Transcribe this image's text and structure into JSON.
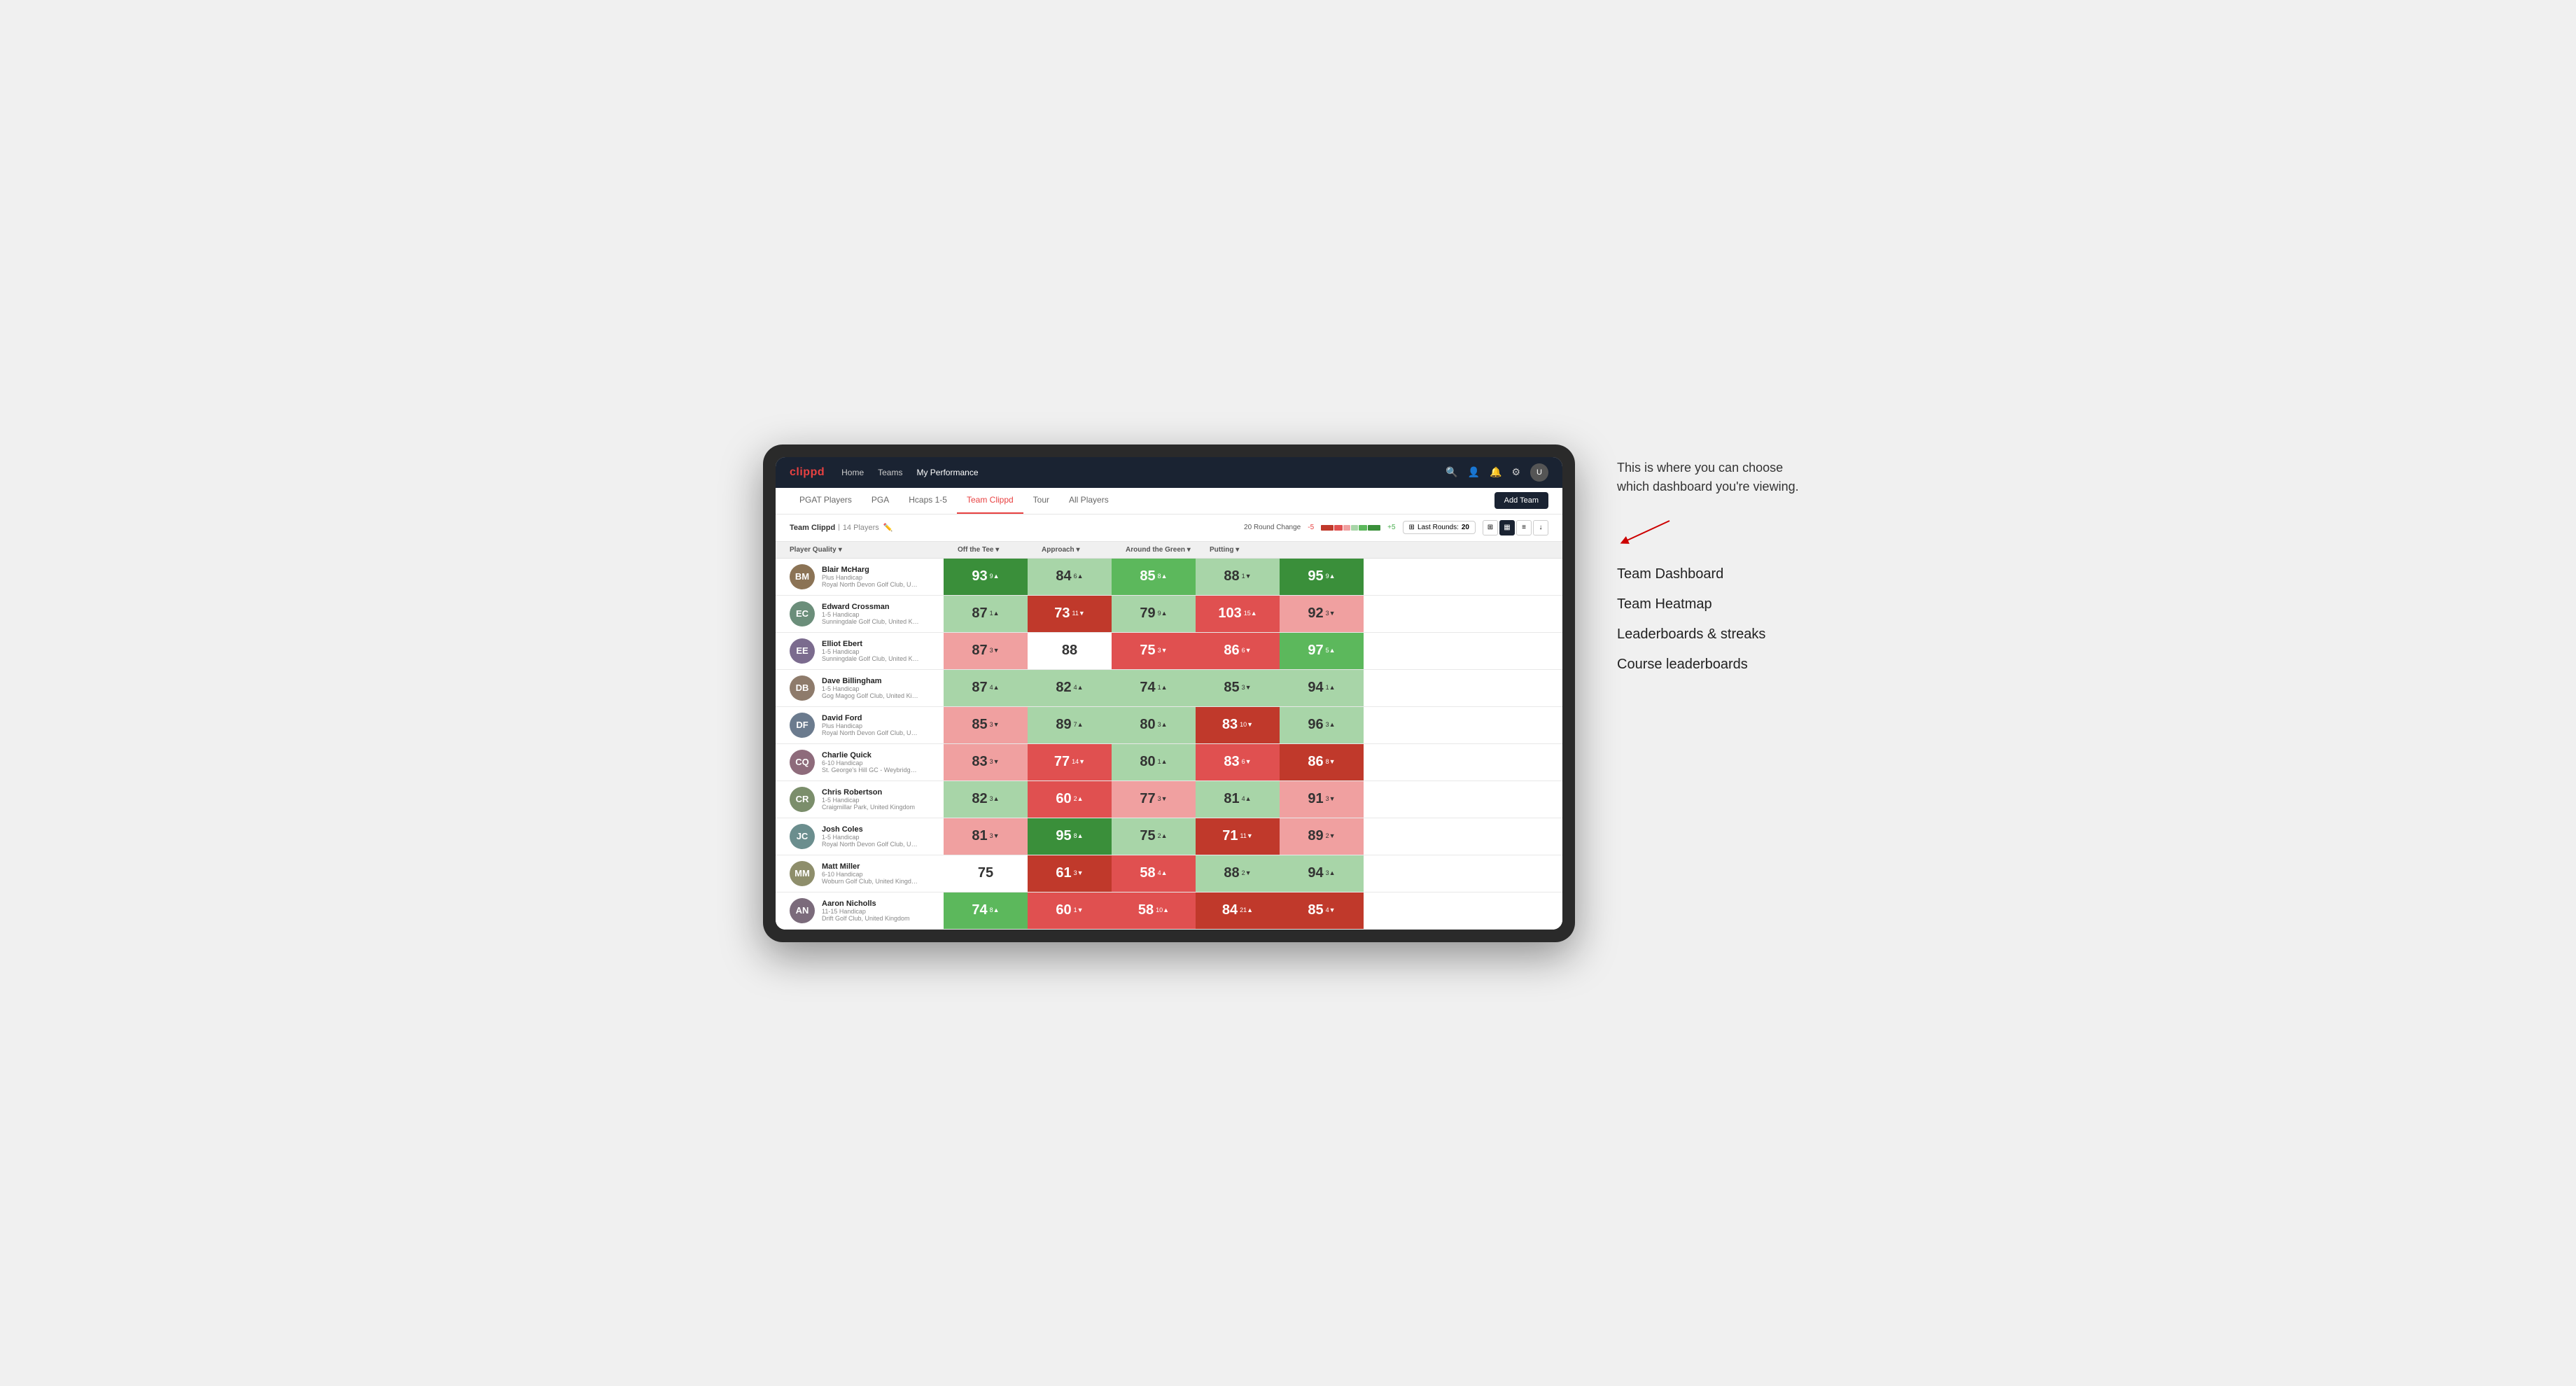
{
  "annotation": {
    "intro_text": "This is where you can choose which dashboard you're viewing.",
    "items": [
      "Team Dashboard",
      "Team Heatmap",
      "Leaderboards & streaks",
      "Course leaderboards"
    ]
  },
  "nav": {
    "logo": "clippd",
    "links": [
      "Home",
      "Teams",
      "My Performance"
    ],
    "active_link": "My Performance"
  },
  "sub_nav": {
    "links": [
      "PGAT Players",
      "PGA",
      "Hcaps 1-5",
      "Team Clippd",
      "Tour",
      "All Players"
    ],
    "active_link": "Team Clippd",
    "add_team_label": "Add Team"
  },
  "team_header": {
    "team_name": "Team Clippd",
    "player_count": "14 Players",
    "round_change_label": "20 Round Change",
    "round_change_minus": "-5",
    "round_change_plus": "+5",
    "last_rounds_label": "Last Rounds:",
    "last_rounds_value": "20"
  },
  "columns": [
    {
      "label": "Player Quality",
      "has_arrow": true
    },
    {
      "label": "Off the Tee",
      "has_arrow": true
    },
    {
      "label": "Approach",
      "has_arrow": true
    },
    {
      "label": "Around the Green",
      "has_arrow": true
    },
    {
      "label": "Putting",
      "has_arrow": true
    }
  ],
  "players": [
    {
      "name": "Blair McHarg",
      "handicap": "Plus Handicap",
      "club": "Royal North Devon Golf Club, United Kingdom",
      "scores": [
        {
          "value": "93",
          "change": "9",
          "dir": "up",
          "color": "green-dark"
        },
        {
          "value": "84",
          "change": "6",
          "dir": "up",
          "color": "green-light"
        },
        {
          "value": "85",
          "change": "8",
          "dir": "up",
          "color": "green-med"
        },
        {
          "value": "88",
          "change": "1",
          "dir": "down",
          "color": "green-light"
        },
        {
          "value": "95",
          "change": "9",
          "dir": "up",
          "color": "green-dark"
        }
      ]
    },
    {
      "name": "Edward Crossman",
      "handicap": "1-5 Handicap",
      "club": "Sunningdale Golf Club, United Kingdom",
      "scores": [
        {
          "value": "87",
          "change": "1",
          "dir": "up",
          "color": "green-light"
        },
        {
          "value": "73",
          "change": "11",
          "dir": "down",
          "color": "red-dark"
        },
        {
          "value": "79",
          "change": "9",
          "dir": "up",
          "color": "green-light"
        },
        {
          "value": "103",
          "change": "15",
          "dir": "up",
          "color": "red-med"
        },
        {
          "value": "92",
          "change": "3",
          "dir": "down",
          "color": "red-light"
        }
      ]
    },
    {
      "name": "Elliot Ebert",
      "handicap": "1-5 Handicap",
      "club": "Sunningdale Golf Club, United Kingdom",
      "scores": [
        {
          "value": "87",
          "change": "3",
          "dir": "down",
          "color": "red-light"
        },
        {
          "value": "88",
          "change": "",
          "dir": "",
          "color": "neutral"
        },
        {
          "value": "75",
          "change": "3",
          "dir": "down",
          "color": "red-med"
        },
        {
          "value": "86",
          "change": "6",
          "dir": "down",
          "color": "red-med"
        },
        {
          "value": "97",
          "change": "5",
          "dir": "up",
          "color": "green-med"
        }
      ]
    },
    {
      "name": "Dave Billingham",
      "handicap": "1-5 Handicap",
      "club": "Gog Magog Golf Club, United Kingdom",
      "scores": [
        {
          "value": "87",
          "change": "4",
          "dir": "up",
          "color": "green-light"
        },
        {
          "value": "82",
          "change": "4",
          "dir": "up",
          "color": "green-light"
        },
        {
          "value": "74",
          "change": "1",
          "dir": "up",
          "color": "green-light"
        },
        {
          "value": "85",
          "change": "3",
          "dir": "down",
          "color": "green-light"
        },
        {
          "value": "94",
          "change": "1",
          "dir": "up",
          "color": "green-light"
        }
      ]
    },
    {
      "name": "David Ford",
      "handicap": "Plus Handicap",
      "club": "Royal North Devon Golf Club, United Kingdom",
      "scores": [
        {
          "value": "85",
          "change": "3",
          "dir": "down",
          "color": "red-light"
        },
        {
          "value": "89",
          "change": "7",
          "dir": "up",
          "color": "green-light"
        },
        {
          "value": "80",
          "change": "3",
          "dir": "up",
          "color": "green-light"
        },
        {
          "value": "83",
          "change": "10",
          "dir": "down",
          "color": "red-dark"
        },
        {
          "value": "96",
          "change": "3",
          "dir": "up",
          "color": "green-light"
        }
      ]
    },
    {
      "name": "Charlie Quick",
      "handicap": "6-10 Handicap",
      "club": "St. George's Hill GC - Weybridge - Surrey, Uni...",
      "scores": [
        {
          "value": "83",
          "change": "3",
          "dir": "down",
          "color": "red-light"
        },
        {
          "value": "77",
          "change": "14",
          "dir": "down",
          "color": "red-med"
        },
        {
          "value": "80",
          "change": "1",
          "dir": "up",
          "color": "green-light"
        },
        {
          "value": "83",
          "change": "6",
          "dir": "down",
          "color": "red-med"
        },
        {
          "value": "86",
          "change": "8",
          "dir": "down",
          "color": "red-dark"
        }
      ]
    },
    {
      "name": "Chris Robertson",
      "handicap": "1-5 Handicap",
      "club": "Craigmillar Park, United Kingdom",
      "scores": [
        {
          "value": "82",
          "change": "3",
          "dir": "up",
          "color": "green-light"
        },
        {
          "value": "60",
          "change": "2",
          "dir": "up",
          "color": "red-med"
        },
        {
          "value": "77",
          "change": "3",
          "dir": "down",
          "color": "red-light"
        },
        {
          "value": "81",
          "change": "4",
          "dir": "up",
          "color": "green-light"
        },
        {
          "value": "91",
          "change": "3",
          "dir": "down",
          "color": "red-light"
        }
      ]
    },
    {
      "name": "Josh Coles",
      "handicap": "1-5 Handicap",
      "club": "Royal North Devon Golf Club, United Kingdom",
      "scores": [
        {
          "value": "81",
          "change": "3",
          "dir": "down",
          "color": "red-light"
        },
        {
          "value": "95",
          "change": "8",
          "dir": "up",
          "color": "green-dark"
        },
        {
          "value": "75",
          "change": "2",
          "dir": "up",
          "color": "green-light"
        },
        {
          "value": "71",
          "change": "11",
          "dir": "down",
          "color": "red-dark"
        },
        {
          "value": "89",
          "change": "2",
          "dir": "down",
          "color": "red-light"
        }
      ]
    },
    {
      "name": "Matt Miller",
      "handicap": "6-10 Handicap",
      "club": "Woburn Golf Club, United Kingdom",
      "scores": [
        {
          "value": "75",
          "change": "",
          "dir": "",
          "color": "neutral"
        },
        {
          "value": "61",
          "change": "3",
          "dir": "down",
          "color": "red-dark"
        },
        {
          "value": "58",
          "change": "4",
          "dir": "up",
          "color": "red-med"
        },
        {
          "value": "88",
          "change": "2",
          "dir": "down",
          "color": "green-light"
        },
        {
          "value": "94",
          "change": "3",
          "dir": "up",
          "color": "green-light"
        }
      ]
    },
    {
      "name": "Aaron Nicholls",
      "handicap": "11-15 Handicap",
      "club": "Drift Golf Club, United Kingdom",
      "scores": [
        {
          "value": "74",
          "change": "8",
          "dir": "up",
          "color": "green-med"
        },
        {
          "value": "60",
          "change": "1",
          "dir": "down",
          "color": "red-med"
        },
        {
          "value": "58",
          "change": "10",
          "dir": "up",
          "color": "red-med"
        },
        {
          "value": "84",
          "change": "21",
          "dir": "up",
          "color": "red-dark"
        },
        {
          "value": "85",
          "change": "4",
          "dir": "down",
          "color": "red-dark"
        }
      ]
    }
  ]
}
